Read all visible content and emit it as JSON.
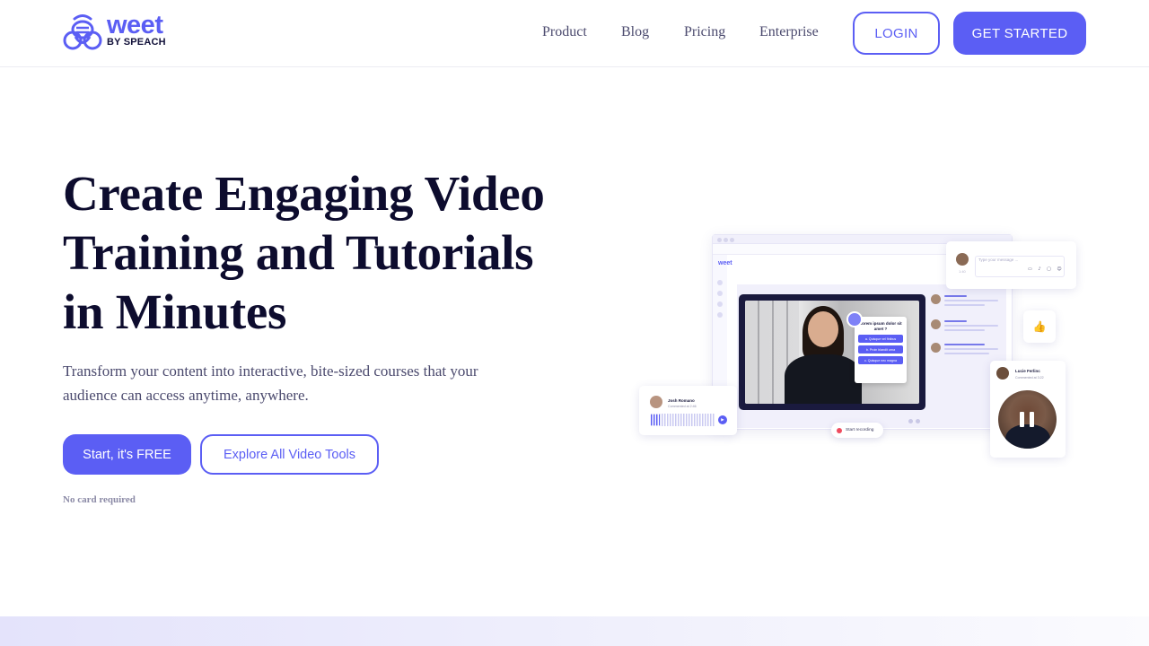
{
  "header": {
    "logo": {
      "word": "weet",
      "sub": "BY SPEACH"
    },
    "nav": [
      {
        "label": "Product"
      },
      {
        "label": "Blog"
      },
      {
        "label": "Pricing"
      },
      {
        "label": "Enterprise"
      }
    ],
    "login_label": "LOGIN",
    "get_started_label": "GET STARTED"
  },
  "hero": {
    "title_line1": "Create Engaging Video",
    "title_line2": "Training and Tutorials",
    "title_line3": "in Minutes",
    "subtitle_line1": "Transform your content into interactive, bite-sized courses that your",
    "subtitle_line2": "audience can access anytime, anywhere.",
    "cta_primary": "Start, it's FREE",
    "cta_secondary": "Explore All Video Tools",
    "note": "No card required"
  },
  "illustration": {
    "app_logo": "weet",
    "chat_placeholder": "Type your message ...",
    "chat_time": "1:40",
    "thumb": "👍",
    "quiz": {
      "question": "Lorem ipsum dolor sit amet ?",
      "options": [
        "a. Quisque vel finibus",
        "b. Proin blandit urna",
        "c. Quisque nec magna"
      ]
    },
    "profile": {
      "name": "Lucie Ferlinc",
      "meta": "Commented at 3:22"
    },
    "voice": {
      "name": "Josh Romano",
      "meta": "Commented at 2:46"
    },
    "record_label": "Start recording"
  },
  "colors": {
    "accent": "#5b5ef4",
    "text_dark": "#0d0c2e",
    "text_muted": "#4b4a6e"
  }
}
